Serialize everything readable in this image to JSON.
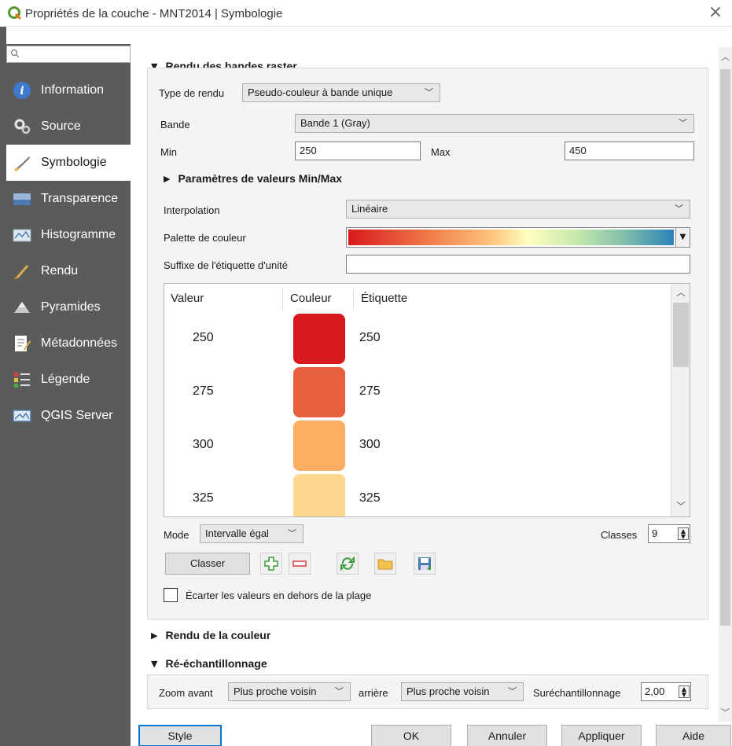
{
  "window": {
    "title": "Propriétés de la couche - MNT2014 | Symbologie",
    "close_glyph": "×"
  },
  "sidebar": {
    "items": [
      {
        "label": "Information",
        "icon": "info-icon"
      },
      {
        "label": "Source",
        "icon": "source-icon"
      },
      {
        "label": "Symbologie",
        "icon": "symbology-icon",
        "active": true
      },
      {
        "label": "Transparence",
        "icon": "transparency-icon"
      },
      {
        "label": "Histogramme",
        "icon": "histogram-icon"
      },
      {
        "label": "Rendu",
        "icon": "render-icon"
      },
      {
        "label": "Pyramides",
        "icon": "pyramids-icon"
      },
      {
        "label": "Métadonnées",
        "icon": "metadata-icon"
      },
      {
        "label": "Légende",
        "icon": "legend-icon"
      },
      {
        "label": "QGIS Server",
        "icon": "qgis-server-icon"
      }
    ]
  },
  "band_rendering": {
    "header": "Rendu des bandes raster",
    "render_type_label": "Type de rendu",
    "render_type_value": "Pseudo-couleur à bande unique",
    "band_label": "Bande",
    "band_value": "Bande 1 (Gray)",
    "min_label": "Min",
    "min_value": "250",
    "max_label": "Max",
    "max_value": "450",
    "minmax_params_header": "Paramètres de valeurs Min/Max",
    "interpolation_label": "Interpolation",
    "interpolation_value": "Linéaire",
    "palette_label": "Palette de couleur",
    "unit_suffix_label": "Suffixe de l'étiquette d'unité",
    "unit_suffix_value": ""
  },
  "table": {
    "columns": [
      "Valeur",
      "Couleur",
      "Étiquette"
    ],
    "rows": [
      {
        "value": "250",
        "color": "#d7191c",
        "label": "250"
      },
      {
        "value": "275",
        "color": "#e8603f",
        "label": "275"
      },
      {
        "value": "300",
        "color": "#fdae61",
        "label": "300"
      },
      {
        "value": "325",
        "color": "#fed88f",
        "label": "325"
      }
    ]
  },
  "classification": {
    "mode_label": "Mode",
    "mode_value": "Intervalle égal",
    "classes_label": "Classes",
    "classes_value": "9",
    "classify_button": "Classer",
    "clip_label": "Écarter les valeurs en dehors de la plage"
  },
  "color_rendering": {
    "header": "Rendu de la couleur"
  },
  "resampling": {
    "header": "Ré-échantillonnage",
    "zoom_in_label": "Zoom avant",
    "zoom_in_value": "Plus proche voisin",
    "zoom_out_label": "arrière",
    "zoom_out_value": "Plus proche voisin",
    "oversampling_label": "Suréchantillonnage",
    "oversampling_value": "2,00"
  },
  "buttons": {
    "style": "Style",
    "ok": "OK",
    "cancel": "Annuler",
    "apply": "Appliquer",
    "help": "Aide"
  },
  "colors": {
    "sidebar_bg": "#5b5b5b",
    "accent": "#0078d7"
  }
}
